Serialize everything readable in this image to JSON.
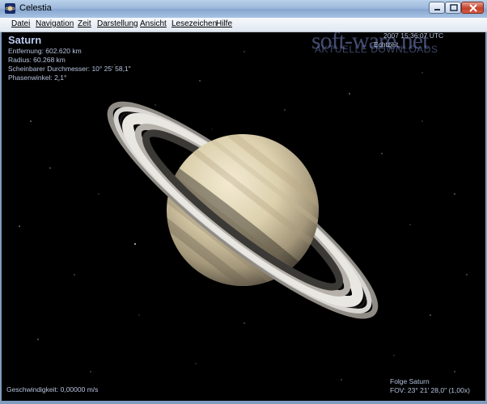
{
  "window": {
    "title": "Celestia"
  },
  "menu": {
    "items": [
      {
        "label": "Datei"
      },
      {
        "label": "Navigation"
      },
      {
        "label": "Zeit"
      },
      {
        "label": "Darstellung"
      },
      {
        "label": "Ansicht"
      },
      {
        "label": "Lesezeichen"
      },
      {
        "label": "Hilfe"
      }
    ]
  },
  "object_info": {
    "name": "Saturn",
    "distance": "Entfernung: 602.620 km",
    "radius": "Radius: 60.268 km",
    "apparent_diameter": "Scheinbarer Durchmesser: 10° 25' 58,1\"",
    "phase_angle": "Phasenwinkel: 2,1°"
  },
  "time_info": {
    "time": "2007 15:36:07 UTC",
    "mode": "Echtzeit"
  },
  "watermark": {
    "brand": "soft-ware.net",
    "tagline": "AKTUELLE DOWNLOADS"
  },
  "status": {
    "speed": "Geschwindigkeit: 0,00000 m/s",
    "follow": "Folge Saturn",
    "fov": "FOV: 23° 21' 28,0\" (1,00x)"
  },
  "colors": {
    "titlebar": "#9db9db",
    "hud_text": "#b7c3de",
    "space": "#000000"
  }
}
